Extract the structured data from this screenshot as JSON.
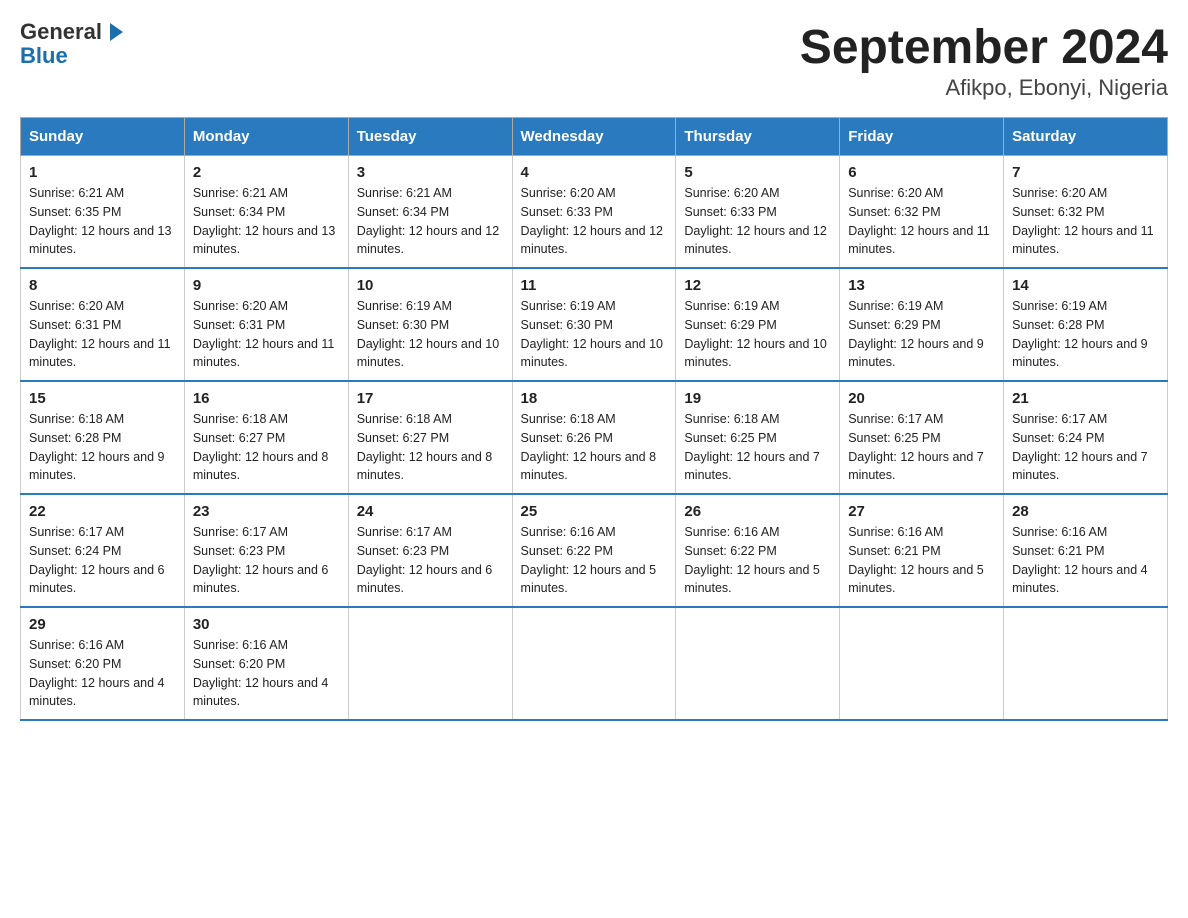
{
  "logo": {
    "general": "General",
    "blue": "Blue"
  },
  "title": "September 2024",
  "subtitle": "Afikpo, Ebonyi, Nigeria",
  "days_of_week": [
    "Sunday",
    "Monday",
    "Tuesday",
    "Wednesday",
    "Thursday",
    "Friday",
    "Saturday"
  ],
  "weeks": [
    [
      {
        "num": "1",
        "sunrise": "6:21 AM",
        "sunset": "6:35 PM",
        "daylight": "12 hours and 13 minutes."
      },
      {
        "num": "2",
        "sunrise": "6:21 AM",
        "sunset": "6:34 PM",
        "daylight": "12 hours and 13 minutes."
      },
      {
        "num": "3",
        "sunrise": "6:21 AM",
        "sunset": "6:34 PM",
        "daylight": "12 hours and 12 minutes."
      },
      {
        "num": "4",
        "sunrise": "6:20 AM",
        "sunset": "6:33 PM",
        "daylight": "12 hours and 12 minutes."
      },
      {
        "num": "5",
        "sunrise": "6:20 AM",
        "sunset": "6:33 PM",
        "daylight": "12 hours and 12 minutes."
      },
      {
        "num": "6",
        "sunrise": "6:20 AM",
        "sunset": "6:32 PM",
        "daylight": "12 hours and 11 minutes."
      },
      {
        "num": "7",
        "sunrise": "6:20 AM",
        "sunset": "6:32 PM",
        "daylight": "12 hours and 11 minutes."
      }
    ],
    [
      {
        "num": "8",
        "sunrise": "6:20 AM",
        "sunset": "6:31 PM",
        "daylight": "12 hours and 11 minutes."
      },
      {
        "num": "9",
        "sunrise": "6:20 AM",
        "sunset": "6:31 PM",
        "daylight": "12 hours and 11 minutes."
      },
      {
        "num": "10",
        "sunrise": "6:19 AM",
        "sunset": "6:30 PM",
        "daylight": "12 hours and 10 minutes."
      },
      {
        "num": "11",
        "sunrise": "6:19 AM",
        "sunset": "6:30 PM",
        "daylight": "12 hours and 10 minutes."
      },
      {
        "num": "12",
        "sunrise": "6:19 AM",
        "sunset": "6:29 PM",
        "daylight": "12 hours and 10 minutes."
      },
      {
        "num": "13",
        "sunrise": "6:19 AM",
        "sunset": "6:29 PM",
        "daylight": "12 hours and 9 minutes."
      },
      {
        "num": "14",
        "sunrise": "6:19 AM",
        "sunset": "6:28 PM",
        "daylight": "12 hours and 9 minutes."
      }
    ],
    [
      {
        "num": "15",
        "sunrise": "6:18 AM",
        "sunset": "6:28 PM",
        "daylight": "12 hours and 9 minutes."
      },
      {
        "num": "16",
        "sunrise": "6:18 AM",
        "sunset": "6:27 PM",
        "daylight": "12 hours and 8 minutes."
      },
      {
        "num": "17",
        "sunrise": "6:18 AM",
        "sunset": "6:27 PM",
        "daylight": "12 hours and 8 minutes."
      },
      {
        "num": "18",
        "sunrise": "6:18 AM",
        "sunset": "6:26 PM",
        "daylight": "12 hours and 8 minutes."
      },
      {
        "num": "19",
        "sunrise": "6:18 AM",
        "sunset": "6:25 PM",
        "daylight": "12 hours and 7 minutes."
      },
      {
        "num": "20",
        "sunrise": "6:17 AM",
        "sunset": "6:25 PM",
        "daylight": "12 hours and 7 minutes."
      },
      {
        "num": "21",
        "sunrise": "6:17 AM",
        "sunset": "6:24 PM",
        "daylight": "12 hours and 7 minutes."
      }
    ],
    [
      {
        "num": "22",
        "sunrise": "6:17 AM",
        "sunset": "6:24 PM",
        "daylight": "12 hours and 6 minutes."
      },
      {
        "num": "23",
        "sunrise": "6:17 AM",
        "sunset": "6:23 PM",
        "daylight": "12 hours and 6 minutes."
      },
      {
        "num": "24",
        "sunrise": "6:17 AM",
        "sunset": "6:23 PM",
        "daylight": "12 hours and 6 minutes."
      },
      {
        "num": "25",
        "sunrise": "6:16 AM",
        "sunset": "6:22 PM",
        "daylight": "12 hours and 5 minutes."
      },
      {
        "num": "26",
        "sunrise": "6:16 AM",
        "sunset": "6:22 PM",
        "daylight": "12 hours and 5 minutes."
      },
      {
        "num": "27",
        "sunrise": "6:16 AM",
        "sunset": "6:21 PM",
        "daylight": "12 hours and 5 minutes."
      },
      {
        "num": "28",
        "sunrise": "6:16 AM",
        "sunset": "6:21 PM",
        "daylight": "12 hours and 4 minutes."
      }
    ],
    [
      {
        "num": "29",
        "sunrise": "6:16 AM",
        "sunset": "6:20 PM",
        "daylight": "12 hours and 4 minutes."
      },
      {
        "num": "30",
        "sunrise": "6:16 AM",
        "sunset": "6:20 PM",
        "daylight": "12 hours and 4 minutes."
      },
      {
        "num": "",
        "sunrise": "",
        "sunset": "",
        "daylight": ""
      },
      {
        "num": "",
        "sunrise": "",
        "sunset": "",
        "daylight": ""
      },
      {
        "num": "",
        "sunrise": "",
        "sunset": "",
        "daylight": ""
      },
      {
        "num": "",
        "sunrise": "",
        "sunset": "",
        "daylight": ""
      },
      {
        "num": "",
        "sunrise": "",
        "sunset": "",
        "daylight": ""
      }
    ]
  ]
}
